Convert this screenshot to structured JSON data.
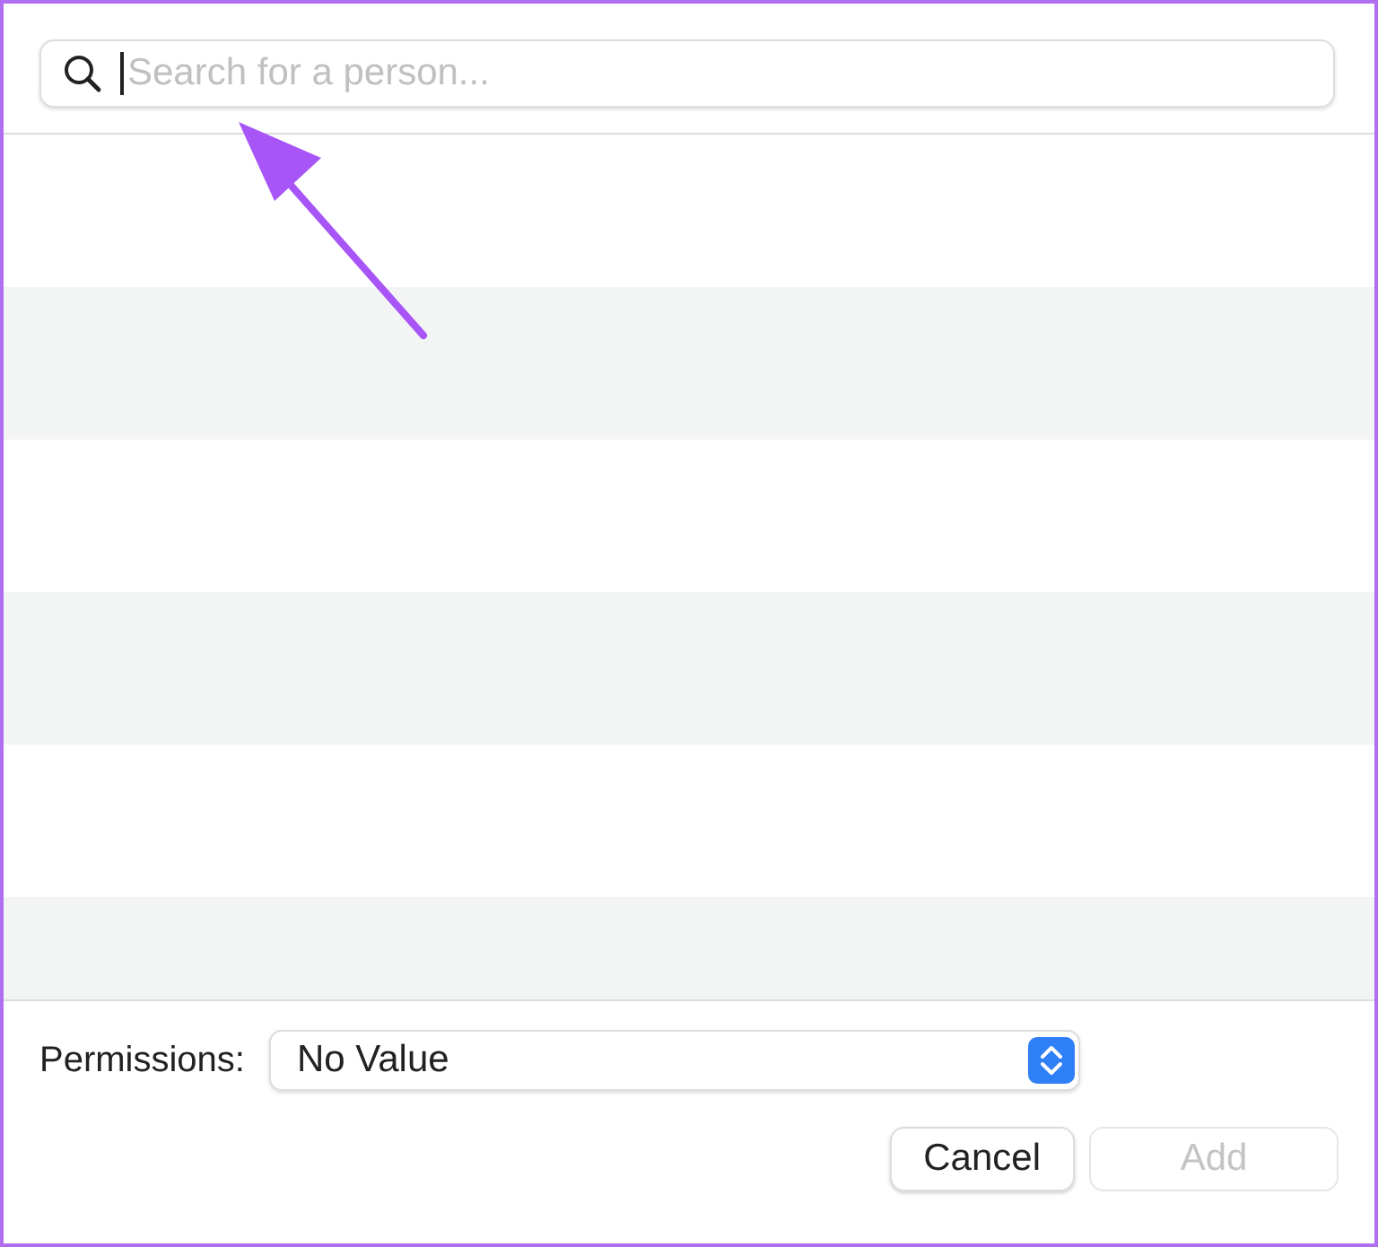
{
  "search": {
    "placeholder": "Search for a person...",
    "focused": true
  },
  "permissions": {
    "label": "Permissions:",
    "value": "No Value"
  },
  "buttons": [
    {
      "label": "Cancel",
      "disabled": false
    },
    {
      "label": "Add",
      "disabled": true
    }
  ]
}
